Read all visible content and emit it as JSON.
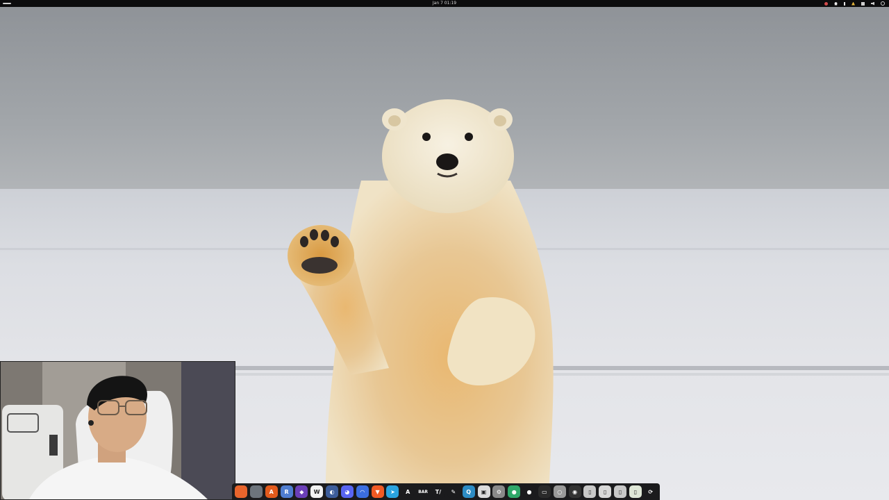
{
  "topbar": {
    "clock": "Jan 7  01:19"
  },
  "webcam": {
    "label": "webcam-overlay"
  },
  "dock": {
    "apps": [
      {
        "name": "firefox-icon",
        "glyph": "",
        "bg": "#e8642c"
      },
      {
        "name": "files-icon",
        "glyph": "",
        "bg": "#6d747c"
      },
      {
        "name": "software-icon",
        "glyph": "A",
        "bg": "#e25a1c"
      },
      {
        "name": "r-icon",
        "glyph": "R",
        "bg": "#4f7dd0"
      },
      {
        "name": "obsidian-icon",
        "glyph": "◆",
        "bg": "#6b3fb8"
      },
      {
        "name": "writer-icon",
        "glyph": "W",
        "bg": "#f2f2f2"
      },
      {
        "name": "record-icon",
        "glyph": "◐",
        "bg": "#3d5d9a"
      },
      {
        "name": "discord-icon",
        "glyph": "◕",
        "bg": "#5865f2"
      },
      {
        "name": "headphones-icon",
        "glyph": "◠",
        "bg": "#3b6ee0"
      },
      {
        "name": "brave-icon",
        "glyph": "▼",
        "bg": "#f15a24"
      },
      {
        "name": "telegram-icon",
        "glyph": "➤",
        "bg": "#2aa3df"
      },
      {
        "name": "arch-icon",
        "glyph": "A",
        "bg": "#1b1b1d"
      },
      {
        "name": "bar-icon",
        "glyph": "BAR",
        "bg": "#1b1b1d"
      },
      {
        "name": "typora-icon",
        "glyph": "T/",
        "bg": "#1b1b1d"
      },
      {
        "name": "edit-icon",
        "glyph": "✎",
        "bg": "#1b1b1d"
      },
      {
        "name": "search-icon",
        "glyph": "Q",
        "bg": "#2d8cc4"
      },
      {
        "name": "screenshot-icon",
        "glyph": "▣",
        "bg": "#dcdcdc"
      },
      {
        "name": "settings-icon",
        "glyph": "⚙",
        "bg": "#8a8a8a"
      },
      {
        "name": "android-icon",
        "glyph": "●",
        "bg": "#2fa86a"
      },
      {
        "name": "disc-icon",
        "glyph": "●",
        "bg": "#1b1b1d"
      },
      {
        "name": "terminal-icon",
        "glyph": "▭",
        "bg": "#2a2a2a"
      },
      {
        "name": "chrome-icon",
        "glyph": "○",
        "bg": "#9a9a9a"
      },
      {
        "name": "obs-icon",
        "glyph": "◉",
        "bg": "#333"
      },
      {
        "name": "document-icon",
        "glyph": "▯",
        "bg": "#c8c8c8"
      },
      {
        "name": "text-editor-icon",
        "glyph": "▯",
        "bg": "#d8d8d8"
      },
      {
        "name": "notes-icon",
        "glyph": "▯",
        "bg": "#c8c8c8"
      },
      {
        "name": "battery-icon",
        "glyph": "▯",
        "bg": "#dfe7d7"
      },
      {
        "name": "app-grid-icon",
        "glyph": "⟳",
        "bg": "#1b1b1d"
      }
    ]
  }
}
